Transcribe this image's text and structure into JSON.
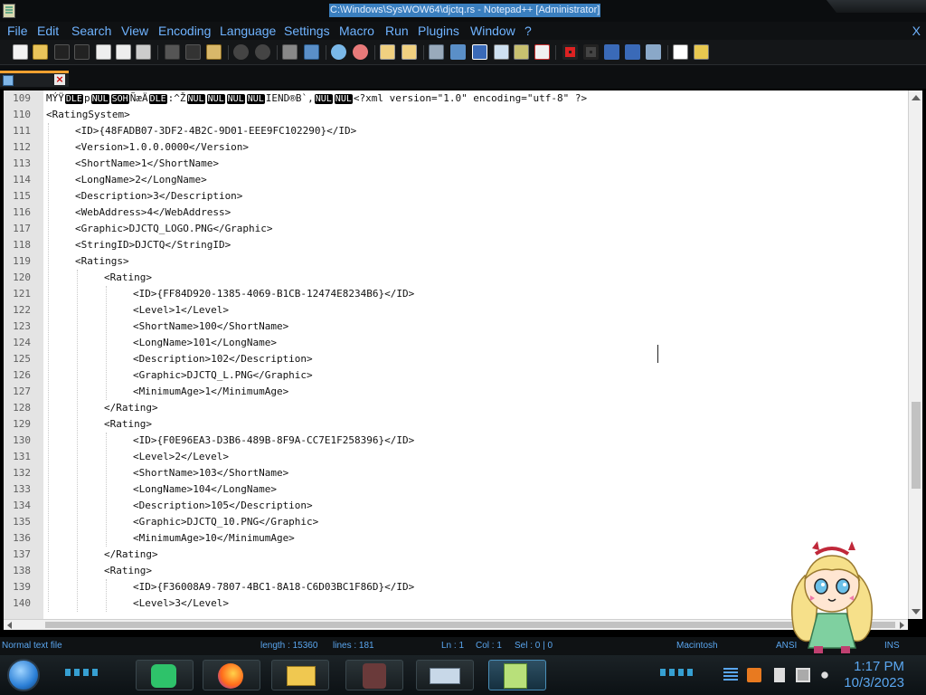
{
  "window": {
    "title": "C:\\Windows\\SysWOW64\\djctq.rs - Notepad++ [Administrator]"
  },
  "menu": {
    "items": [
      "File",
      "Edit",
      "Search",
      "View",
      "Encoding",
      "Language",
      "Settings",
      "Macro",
      "Run",
      "Plugins",
      "Window",
      "?"
    ],
    "close": "X"
  },
  "toolbar": {
    "icons": [
      "new-file-icon",
      "open-icon",
      "save-icon",
      "save-all-icon",
      "close-icon",
      "close-all-icon",
      "print-icon",
      "cut-icon",
      "copy-icon",
      "paste-icon",
      "undo-icon",
      "redo-icon",
      "find-icon",
      "replace-icon",
      "zoom-in-icon",
      "zoom-out-icon",
      "sync-v-icon",
      "sync-h-icon",
      "word-wrap-icon",
      "show-all-chars-icon",
      "indent-guide-icon",
      "doc-map-icon",
      "function-list-icon",
      "folder-workspace-icon",
      "record-macro-icon",
      "stop-macro-icon",
      "play-macro-icon",
      "run-macro-multi-icon",
      "save-macro-icon",
      "spellcheck-icon",
      "plugin-icon"
    ]
  },
  "editor": {
    "first_line_prefix": "MÝŸ",
    "lines": [
      {
        "n": "109",
        "indent": 0,
        "special": true
      },
      {
        "n": "110",
        "indent": 0,
        "text": "<RatingSystem>"
      },
      {
        "n": "111",
        "indent": 1,
        "text": "<ID>{48FADB07-3DF2-4B2C-9D01-EEE9FC102290}</ID>"
      },
      {
        "n": "112",
        "indent": 1,
        "text": "<Version>1.0.0.0000</Version>"
      },
      {
        "n": "113",
        "indent": 1,
        "text": "<ShortName>1</ShortName>"
      },
      {
        "n": "114",
        "indent": 1,
        "text": "<LongName>2</LongName>"
      },
      {
        "n": "115",
        "indent": 1,
        "text": "<Description>3</Description>"
      },
      {
        "n": "116",
        "indent": 1,
        "text": "<WebAddress>4</WebAddress>"
      },
      {
        "n": "117",
        "indent": 1,
        "text": "<Graphic>DJCTQ_LOGO.PNG</Graphic>"
      },
      {
        "n": "118",
        "indent": 1,
        "text": "<StringID>DJCTQ</StringID>"
      },
      {
        "n": "119",
        "indent": 1,
        "text": "<Ratings>"
      },
      {
        "n": "120",
        "indent": 2,
        "text": "<Rating>"
      },
      {
        "n": "121",
        "indent": 3,
        "text": "<ID>{FF84D920-1385-4069-B1CB-12474E8234B6}</ID>"
      },
      {
        "n": "122",
        "indent": 3,
        "text": "<Level>1</Level>"
      },
      {
        "n": "123",
        "indent": 3,
        "text": "<ShortName>100</ShortName>"
      },
      {
        "n": "124",
        "indent": 3,
        "text": "<LongName>101</LongName>"
      },
      {
        "n": "125",
        "indent": 3,
        "text": "<Description>102</Description>"
      },
      {
        "n": "126",
        "indent": 3,
        "text": "<Graphic>DJCTQ_L.PNG</Graphic>"
      },
      {
        "n": "127",
        "indent": 3,
        "text": "<MinimumAge>1</MinimumAge>"
      },
      {
        "n": "128",
        "indent": 2,
        "text": "</Rating>"
      },
      {
        "n": "129",
        "indent": 2,
        "text": "<Rating>"
      },
      {
        "n": "130",
        "indent": 3,
        "text": "<ID>{F0E96EA3-D3B6-489B-8F9A-CC7E1F258396}</ID>"
      },
      {
        "n": "131",
        "indent": 3,
        "text": "<Level>2</Level>"
      },
      {
        "n": "132",
        "indent": 3,
        "text": "<ShortName>103</ShortName>"
      },
      {
        "n": "133",
        "indent": 3,
        "text": "<LongName>104</LongName>"
      },
      {
        "n": "134",
        "indent": 3,
        "text": "<Description>105</Description>"
      },
      {
        "n": "135",
        "indent": 3,
        "text": "<Graphic>DJCTQ_10.PNG</Graphic>"
      },
      {
        "n": "136",
        "indent": 3,
        "text": "<MinimumAge>10</MinimumAge>"
      },
      {
        "n": "137",
        "indent": 2,
        "text": "</Rating>"
      },
      {
        "n": "138",
        "indent": 2,
        "text": "<Rating>"
      },
      {
        "n": "139",
        "indent": 3,
        "text": "<ID>{F36008A9-7807-4BC1-8A18-C6D03BC1F86D}</ID>"
      },
      {
        "n": "140",
        "indent": 3,
        "text": "<Level>3</Level>"
      }
    ]
  },
  "status": {
    "file_type": "Normal text file",
    "length": "length : 15360",
    "lines": "lines : 181",
    "ln": "Ln : 1",
    "col": "Col : 1",
    "sel": "Sel : 0 | 0",
    "eol": "Macintosh",
    "encoding": "ANSI",
    "mode": "INS"
  },
  "taskbar": {
    "time": "1:17 PM",
    "date": "10/3/2023",
    "apps": [
      "notes-app-icon",
      "firefox-icon",
      "file-explorer-icon",
      "avatar-app-icon",
      "network-tool-icon",
      "notepad-plus-plus-icon"
    ]
  },
  "colors": {
    "menu_text": "#6fb3ff",
    "status_text": "#5aa6ef",
    "title_highlight": "#3a7fbf",
    "tab_accent": "#f0a030"
  }
}
